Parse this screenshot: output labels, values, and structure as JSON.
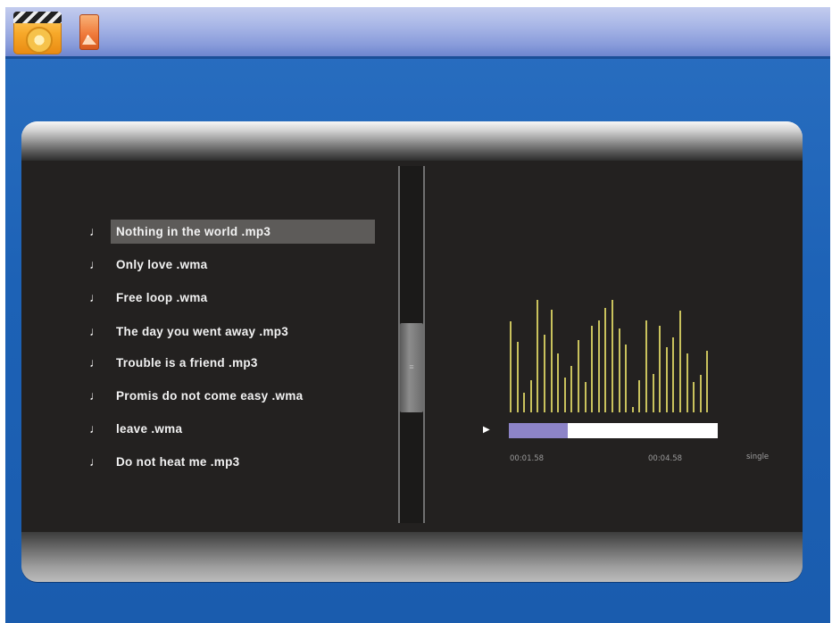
{
  "top_bar": {
    "icons": [
      {
        "name": "movie-icon"
      },
      {
        "name": "photo-icon"
      }
    ]
  },
  "playlist": {
    "selected_index": 0,
    "tracks": [
      "Nothing in the world .mp3",
      "Only love .wma",
      "Free loop .wma",
      "The day you went away .mp3",
      "Trouble is a friend .mp3",
      "Promis do not come easy .wma",
      "leave .wma",
      "Do not heat me .mp3"
    ]
  },
  "scrollbar": {
    "thumb_position": 0.45,
    "thumb_size": 0.25
  },
  "player": {
    "play_icon": "play-icon",
    "current_time": "00:01.58",
    "total_time": "00:04.58",
    "progress": 0.28,
    "mode": "single",
    "progress_fill_color": "#8d84c8",
    "visualizer_color": "#c9c25d",
    "visualizer_levels": [
      0.68,
      0.53,
      0.15,
      0.24,
      0.84,
      0.58,
      0.77,
      0.44,
      0.26,
      0.35,
      0.54,
      0.23,
      0.65,
      0.69,
      0.78,
      0.84,
      0.63,
      0.51,
      0.04,
      0.24,
      0.69,
      0.29,
      0.65,
      0.49,
      0.56,
      0.76,
      0.44,
      0.23,
      0.28,
      0.46
    ]
  }
}
